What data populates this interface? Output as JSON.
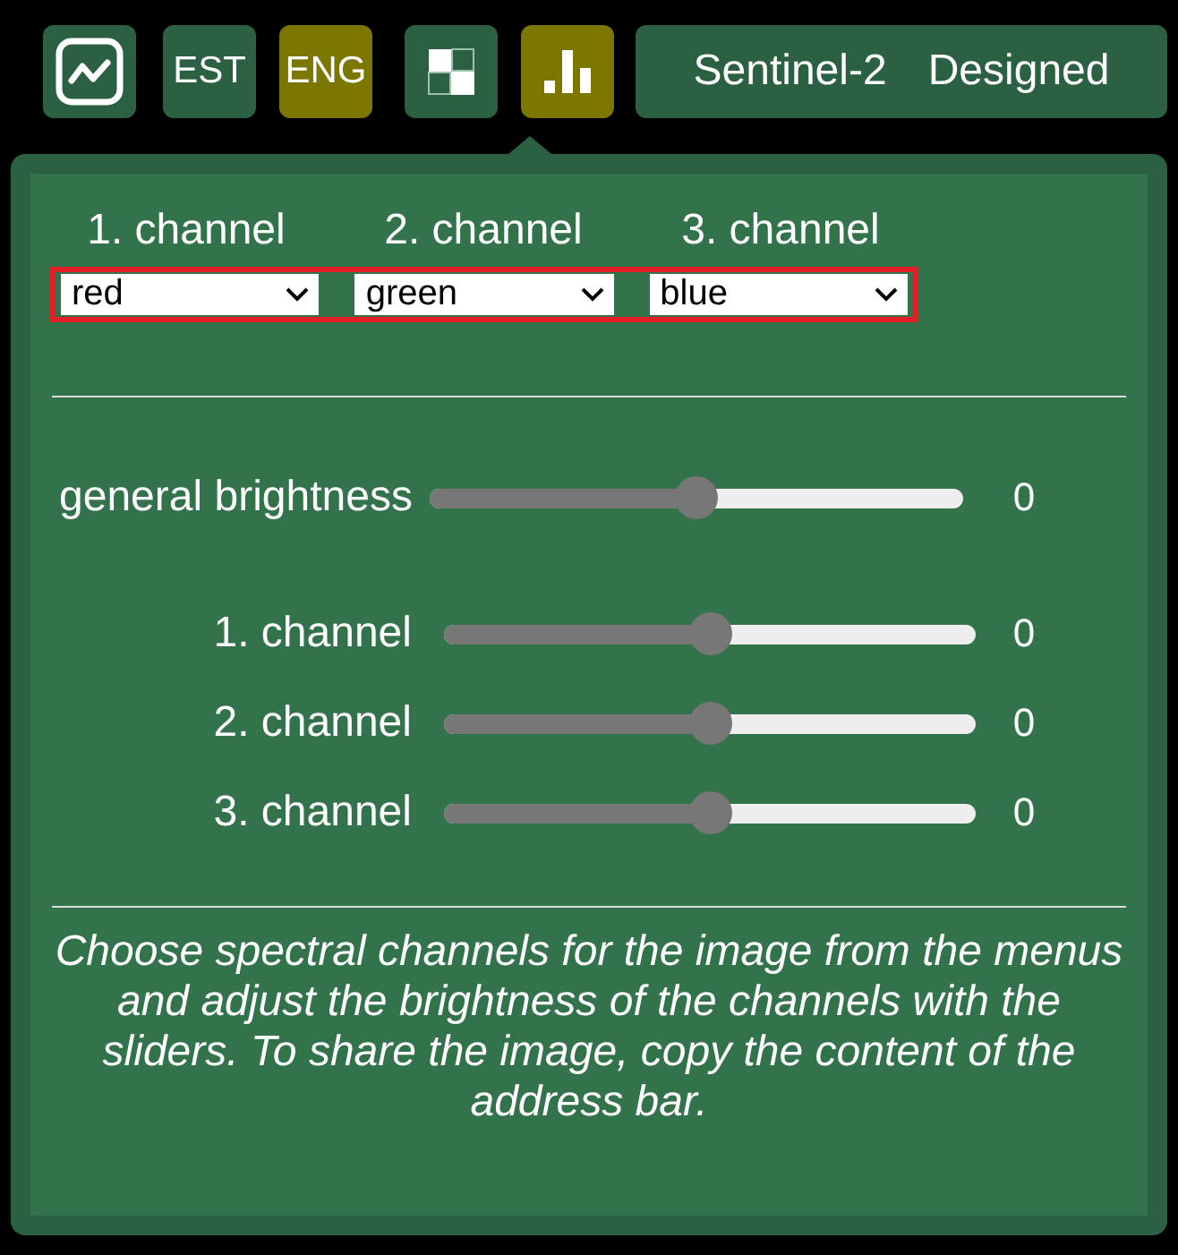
{
  "toolbar": {
    "languages": [
      {
        "label": "EST",
        "selected": false
      },
      {
        "label": "ENG",
        "selected": true
      }
    ],
    "view_tabs": [
      {
        "kind": "grid",
        "selected": false
      },
      {
        "kind": "bars",
        "selected": true
      }
    ],
    "title": {
      "satellite": "Sentinel-2",
      "mode": "Designed"
    }
  },
  "panel": {
    "channel_selects": {
      "highlighted": true,
      "items": [
        {
          "label": "1. channel",
          "value": "red"
        },
        {
          "label": "2. channel",
          "value": "green"
        },
        {
          "label": "3. channel",
          "value": "blue"
        }
      ]
    },
    "general_brightness": {
      "label": "general brightness",
      "level": 0.5,
      "reading": "0"
    },
    "channel_sliders": [
      {
        "label": "1. channel",
        "level": 0.5,
        "reading": "0"
      },
      {
        "label": "2. channel",
        "level": 0.5,
        "reading": "0"
      },
      {
        "label": "3. channel",
        "level": 0.5,
        "reading": "0"
      }
    ],
    "help_text": "Choose spectral channels for the image from the menus and adjust the brightness of the channels with the sliders. To share the image, copy the content of the address bar."
  }
}
